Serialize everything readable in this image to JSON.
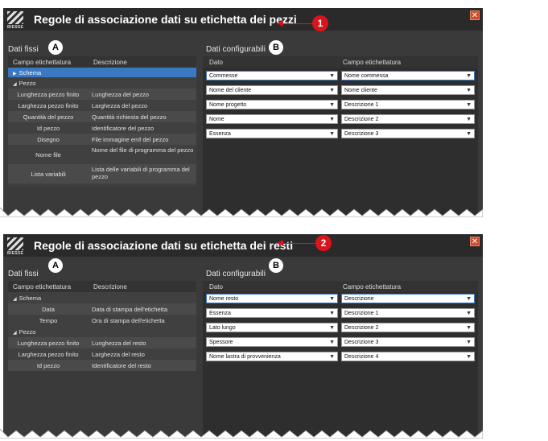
{
  "dialogs": [
    {
      "title": "Regole di associazione dati su etichetta dei pezzi",
      "logo_text": "BIESSE",
      "close_label": "✕",
      "callout": "1",
      "left": {
        "label": "Dati fissi",
        "badge": "A",
        "col1": "Campo etichettatura",
        "col2": "Descrizione",
        "rows": [
          {
            "type": "group",
            "label": "Schema",
            "selected": true
          },
          {
            "type": "group",
            "label": "Pezzo",
            "selected": false
          },
          {
            "type": "item",
            "field": "Lunghezza pezzo finito",
            "desc": "Lunghezza del pezzo"
          },
          {
            "type": "item",
            "field": "Larghezza pezzo finito",
            "desc": "Larghezza del pezzo"
          },
          {
            "type": "item",
            "field": "Quantità del pezzo",
            "desc": "Quantità richiesta del pezzo"
          },
          {
            "type": "item",
            "field": "Id pezzo",
            "desc": "Identificatore del pezzo"
          },
          {
            "type": "item",
            "field": "Disegno",
            "desc": "File immagine emf del pezzo"
          },
          {
            "type": "item",
            "field": "Nome file",
            "desc": "Nome del file di programma del pezzo",
            "tall": true
          },
          {
            "type": "item",
            "field": "Lista variabili",
            "desc": "Lista delle variabili di programma del pezzo",
            "tall": true
          }
        ]
      },
      "right": {
        "label": "Dati configurabili",
        "badge": "B",
        "col1": "Dato",
        "col2": "Campo etichettatura",
        "rows": [
          {
            "dato": "Commesse",
            "campo": "Nome commessa"
          },
          {
            "dato": "Nome del cliente",
            "campo": "Nome cliente"
          },
          {
            "dato": "Nome progetto",
            "campo": "Descrizione 1"
          },
          {
            "dato": "Nome",
            "campo": "Descrizione 2"
          },
          {
            "dato": "Essenza",
            "campo": "Descrizione 3"
          }
        ]
      }
    },
    {
      "title": "Regole di associazione dati su etichetta dei resti",
      "logo_text": "BIESSE",
      "close_label": "✕",
      "callout": "2",
      "left": {
        "label": "Dati fissi",
        "badge": "A",
        "col1": "Campo etichettatura",
        "col2": "Descrizione",
        "rows": [
          {
            "type": "group",
            "label": "Schema",
            "selected": false
          },
          {
            "type": "item",
            "field": "Data",
            "desc": "Data di stampa dell'etichetta"
          },
          {
            "type": "item",
            "field": "Tempo",
            "desc": "Ora di stampa dell'etichetta"
          },
          {
            "type": "group",
            "label": "Pezzo",
            "selected": false
          },
          {
            "type": "item",
            "field": "Lunghezza pezzo finito",
            "desc": "Lunghezza del resto"
          },
          {
            "type": "item",
            "field": "Larghezza pezzo finito",
            "desc": "Larghezza del resto"
          },
          {
            "type": "item",
            "field": "Id pezzo",
            "desc": "Identificatore del resto"
          }
        ]
      },
      "right": {
        "label": "Dati configurabili",
        "badge": "B",
        "col1": "Dato",
        "col2": "Campo etichettatura",
        "rows": [
          {
            "dato": "Nome resto",
            "campo": "Descrizione"
          },
          {
            "dato": "Essenza",
            "campo": "Descrizione 1"
          },
          {
            "dato": "Lato lungo",
            "campo": "Descrizione 2"
          },
          {
            "dato": "Spessore",
            "campo": "Descrizione 3"
          },
          {
            "dato": "Nome lastra di provvenienza",
            "campo": "Descrizione 4"
          }
        ]
      }
    }
  ],
  "colors": {
    "background": "#3a3a3a",
    "selection": "#3a78c2",
    "callout": "#d8151c"
  }
}
